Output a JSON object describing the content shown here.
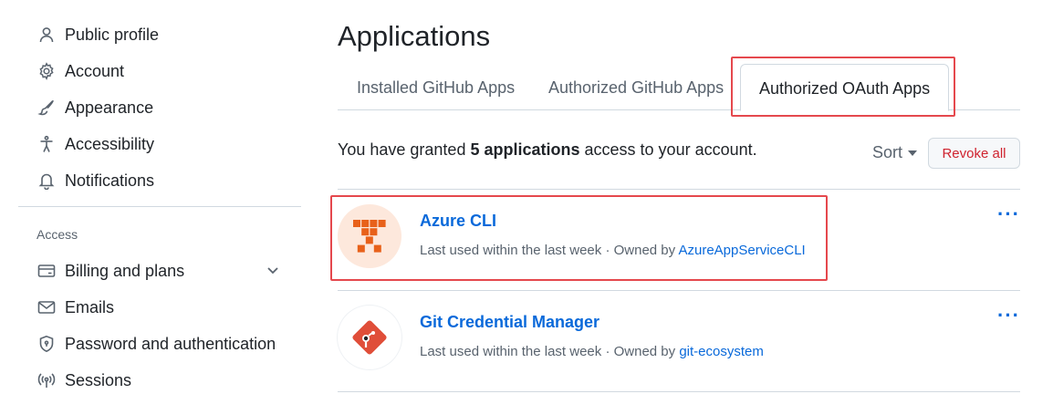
{
  "sidebar": {
    "items": [
      {
        "label": "Public profile",
        "icon": "person-icon"
      },
      {
        "label": "Account",
        "icon": "gear-icon"
      },
      {
        "label": "Appearance",
        "icon": "paintbrush-icon"
      },
      {
        "label": "Accessibility",
        "icon": "accessibility-icon"
      },
      {
        "label": "Notifications",
        "icon": "bell-icon"
      }
    ],
    "access_label": "Access",
    "access_items": [
      {
        "label": "Billing and plans",
        "icon": "credit-card-icon",
        "has_chevron": true
      },
      {
        "label": "Emails",
        "icon": "mail-icon"
      },
      {
        "label": "Password and authentication",
        "icon": "shield-lock-icon"
      },
      {
        "label": "Sessions",
        "icon": "broadcast-icon"
      }
    ]
  },
  "main": {
    "title": "Applications",
    "tabs": [
      {
        "label": "Installed GitHub Apps",
        "active": false
      },
      {
        "label": "Authorized GitHub Apps",
        "active": false
      },
      {
        "label": "Authorized OAuth Apps",
        "active": true
      }
    ],
    "grant_prefix": "You have granted ",
    "grant_count": "5 applications",
    "grant_suffix": " access to your account.",
    "sort_label": "Sort",
    "revoke_all_label": "Revoke all",
    "apps": [
      {
        "name": "Azure CLI",
        "meta_prefix": "Last used within the last week · Owned by ",
        "owner": "AzureAppServiceCLI",
        "more": "···",
        "logo_color": "#e8611a",
        "logo_bg": "#fde8dc"
      },
      {
        "name": "Git Credential Manager",
        "meta_prefix": "Last used within the last week · Owned by ",
        "owner": "git-ecosystem",
        "more": "···",
        "logo_color": "#e04e39",
        "logo_bg": "#ffffff"
      }
    ]
  },
  "colors": {
    "accent": "#0969da",
    "danger": "#cf222e",
    "highlight": "#e5484d"
  }
}
